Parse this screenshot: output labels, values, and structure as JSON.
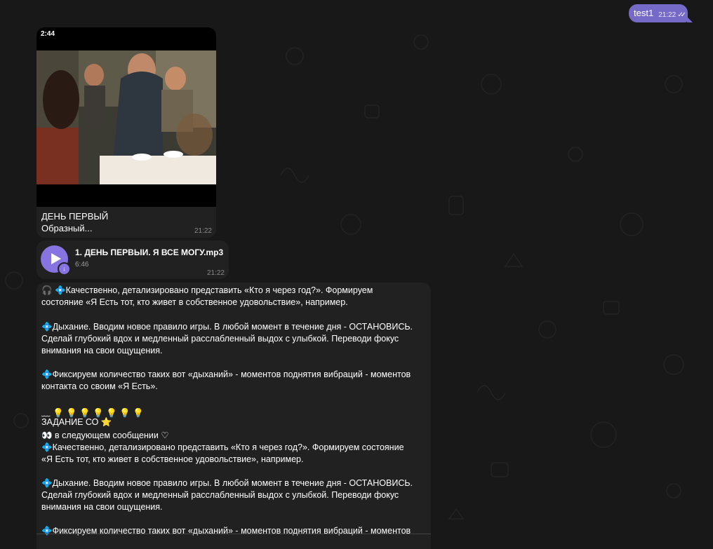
{
  "outgoing": {
    "text": "test1",
    "time": "21:22"
  },
  "video_message": {
    "duration": "2:44",
    "caption_title": "ДЕНЬ ПЕРВЫЙ",
    "caption_preview": "Образный...",
    "time": "21:22"
  },
  "audio_message": {
    "title": "1. ДЕНЬ ПЕРВЫИ. Я ВСЕ МОГУ.mp3",
    "duration": "6:46",
    "time": "21:22"
  },
  "text_message": {
    "lines": [
      "🎧 💠Качественно, детализировано  представить «Кто я через год?». Формируем",
      "состояние «Я Есть тот, кто живет в собственное удовольствие», например.",
      "",
      "💠Дыхание. Вводим новое правило игры. В любой момент в течение дня - ОСТАНОВИСЬ.",
      "Сделай глубокий вдох и медленный расслабленный выдох с улыбкой. Переводи фокус",
      "внимания на свои ощущения.",
      "",
      "💠Фиксируем количество таких вот «дыханий» - моментов поднятия вибраций - моментов",
      "контакта со своим «Я Есть».",
      "",
      "﹏ 💡 💡 💡 💡 💡 💡 💡",
      "ЗАДАНИЕ СО ⭐",
      "👀 в следующем сообщении ♡",
      "💠Качественно, детализировано  представить «Кто я через год?». Формируем состояние",
      "«Я Есть тот, кто живет в собственное удовольствие», например.",
      "",
      "💠Дыхание. Вводим новое правило игры. В любой момент в течение дня - ОСТАНОВИСЬ.",
      "Сделай глубокий вдох и медленный расслабленный выдох с улыбкой. Переводи фокус",
      "внимания на свои ощущения.",
      "",
      "💠Фиксируем количество таких вот «дыханий» - моментов поднятия вибраций - моментов"
    ]
  },
  "colors": {
    "background": "#181818",
    "bubble_incoming": "#212121",
    "bubble_outgoing": "#766ac8",
    "accent": "#8774e1"
  },
  "icons": {
    "play": "play-icon",
    "download": "download-icon",
    "read_checks": "double-check-icon"
  }
}
